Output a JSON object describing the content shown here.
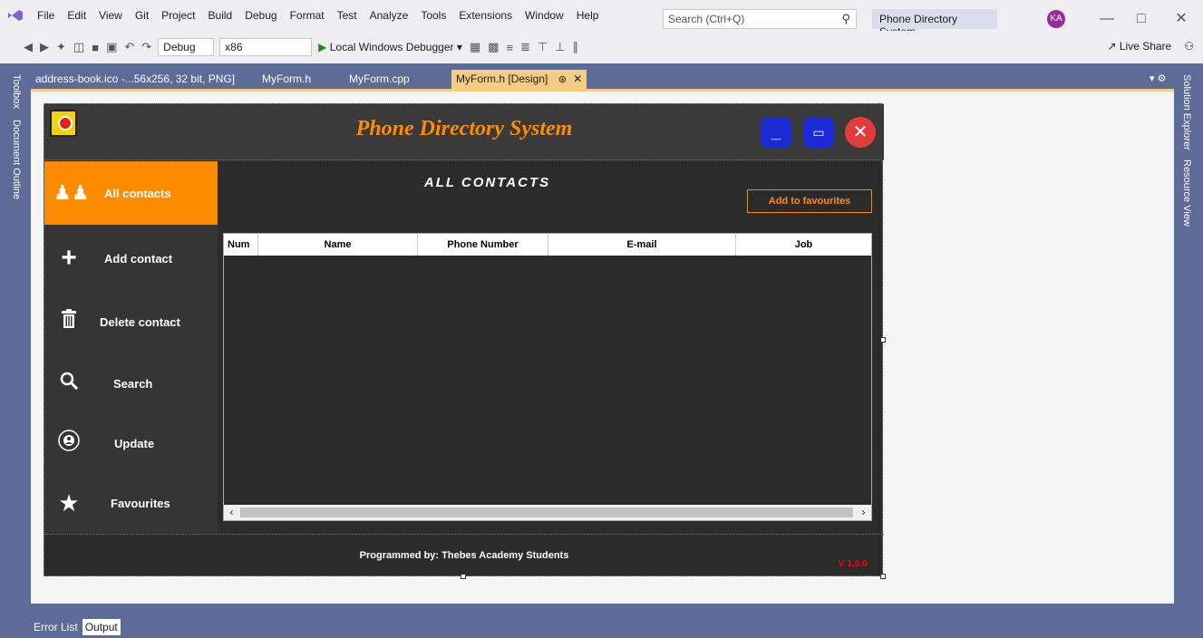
{
  "menubar": {
    "items": [
      "File",
      "Edit",
      "View",
      "Git",
      "Project",
      "Build",
      "Debug",
      "Format",
      "Test",
      "Analyze",
      "Tools",
      "Extensions",
      "Window",
      "Help"
    ],
    "search_placeholder": "Search (Ctrl+Q)",
    "solution_name": "Phone Directory System",
    "avatar_initials": "KA"
  },
  "toolbar": {
    "configuration": "Debug",
    "platform": "x86",
    "run_label": "Local Windows Debugger",
    "live_share": "Live Share"
  },
  "docks": {
    "left": [
      "Toolbox",
      "Document Outline"
    ],
    "right": [
      "Solution Explorer",
      "Resource View"
    ]
  },
  "tabs": [
    {
      "label": "address-book.ico -...56x256, 32 bit, PNG]",
      "active": false
    },
    {
      "label": "MyForm.h",
      "active": false
    },
    {
      "label": "MyForm.cpp",
      "active": false
    },
    {
      "label": "MyForm.h [Design]",
      "active": true
    }
  ],
  "app": {
    "title": "Phone Directory System",
    "sidebar": [
      {
        "label": "All contacts",
        "icon": "users-icon",
        "active": true
      },
      {
        "label": "Add contact",
        "icon": "plus-icon",
        "active": false
      },
      {
        "label": "Delete contact",
        "icon": "trash-icon",
        "active": false
      },
      {
        "label": "Search",
        "icon": "search-icon",
        "active": false
      },
      {
        "label": "Update",
        "icon": "update-user-icon",
        "active": false
      },
      {
        "label": "Favourites",
        "icon": "star-icon",
        "active": false
      }
    ],
    "content_title": "ALL CONTACTS",
    "fav_button": "Add to favourites",
    "grid_columns": [
      "Num",
      "Name",
      "Phone Number",
      "E-mail",
      "Job"
    ],
    "footer": "Programmed by: Thebes Academy Students",
    "version": "V 1.0.0"
  },
  "bottom_tabs": [
    {
      "label": "Error List",
      "active": false
    },
    {
      "label": "Output",
      "active": true
    }
  ],
  "colors": {
    "accent_orange": "#ff8c00",
    "form_bg": "#2b2b2b",
    "chrome_blue": "#5d6b99",
    "tab_active": "#f5cc84"
  }
}
